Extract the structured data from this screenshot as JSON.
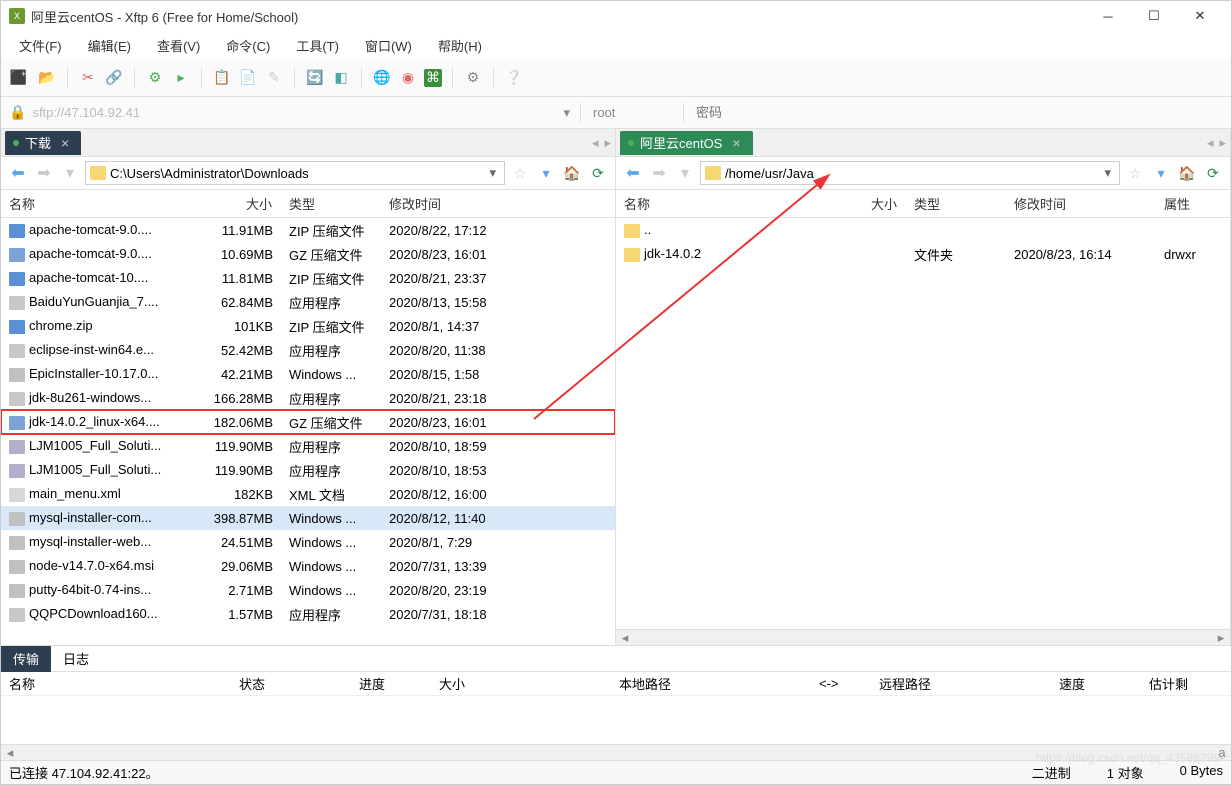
{
  "titlebar": {
    "title": "阿里云centOS - Xftp 6 (Free for Home/School)"
  },
  "menu": [
    "文件(F)",
    "编辑(E)",
    "查看(V)",
    "命令(C)",
    "工具(T)",
    "窗口(W)",
    "帮助(H)"
  ],
  "address": {
    "url": "sftp://47.104.92.41",
    "user": "root",
    "password_placeholder": "密码"
  },
  "left": {
    "tab": "下载",
    "path": "C:\\Users\\Administrator\\Downloads",
    "cols": {
      "name": "名称",
      "size": "大小",
      "type": "类型",
      "mtime": "修改时间"
    },
    "files": [
      {
        "name": "apache-tomcat-9.0....",
        "size": "11.91MB",
        "type": "ZIP 压缩文件",
        "mtime": "2020/8/22, 17:12",
        "icon": "zip"
      },
      {
        "name": "apache-tomcat-9.0....",
        "size": "10.69MB",
        "type": "GZ 压缩文件",
        "mtime": "2020/8/23, 16:01",
        "icon": "gz"
      },
      {
        "name": "apache-tomcat-10....",
        "size": "11.81MB",
        "type": "ZIP 压缩文件",
        "mtime": "2020/8/21, 23:37",
        "icon": "zip"
      },
      {
        "name": "BaiduYunGuanjia_7....",
        "size": "62.84MB",
        "type": "应用程序",
        "mtime": "2020/8/13, 15:58",
        "icon": "exe"
      },
      {
        "name": "chrome.zip",
        "size": "101KB",
        "type": "ZIP 压缩文件",
        "mtime": "2020/8/1, 14:37",
        "icon": "zip"
      },
      {
        "name": "eclipse-inst-win64.e...",
        "size": "52.42MB",
        "type": "应用程序",
        "mtime": "2020/8/20, 11:38",
        "icon": "exe"
      },
      {
        "name": "EpicInstaller-10.17.0...",
        "size": "42.21MB",
        "type": "Windows ...",
        "mtime": "2020/8/15, 1:58",
        "icon": "msi"
      },
      {
        "name": "jdk-8u261-windows...",
        "size": "166.28MB",
        "type": "应用程序",
        "mtime": "2020/8/21, 23:18",
        "icon": "exe"
      },
      {
        "name": "jdk-14.0.2_linux-x64....",
        "size": "182.06MB",
        "type": "GZ 压缩文件",
        "mtime": "2020/8/23, 16:01",
        "icon": "gz",
        "highlight": true
      },
      {
        "name": "LJM1005_Full_Soluti...",
        "size": "119.90MB",
        "type": "应用程序",
        "mtime": "2020/8/10, 18:59",
        "icon": "ins"
      },
      {
        "name": "LJM1005_Full_Soluti...",
        "size": "119.90MB",
        "type": "应用程序",
        "mtime": "2020/8/10, 18:53",
        "icon": "ins"
      },
      {
        "name": "main_menu.xml",
        "size": "182KB",
        "type": "XML 文档",
        "mtime": "2020/8/12, 16:00",
        "icon": "xml"
      },
      {
        "name": "mysql-installer-com...",
        "size": "398.87MB",
        "type": "Windows ...",
        "mtime": "2020/8/12, 11:40",
        "icon": "msi",
        "sel": true
      },
      {
        "name": "mysql-installer-web...",
        "size": "24.51MB",
        "type": "Windows ...",
        "mtime": "2020/8/1, 7:29",
        "icon": "msi"
      },
      {
        "name": "node-v14.7.0-x64.msi",
        "size": "29.06MB",
        "type": "Windows ...",
        "mtime": "2020/7/31, 13:39",
        "icon": "msi"
      },
      {
        "name": "putty-64bit-0.74-ins...",
        "size": "2.71MB",
        "type": "Windows ...",
        "mtime": "2020/8/20, 23:19",
        "icon": "msi"
      },
      {
        "name": "QQPCDownload160...",
        "size": "1.57MB",
        "type": "应用程序",
        "mtime": "2020/7/31, 18:18",
        "icon": "exe"
      }
    ]
  },
  "right": {
    "tab": "阿里云centOS",
    "path": "/home/usr/Java",
    "cols": {
      "name": "名称",
      "size": "大小",
      "type": "类型",
      "mtime": "修改时间",
      "attr": "属性"
    },
    "files": [
      {
        "name": "..",
        "size": "",
        "type": "",
        "mtime": "",
        "icon": "folder",
        "attr": ""
      },
      {
        "name": "jdk-14.0.2",
        "size": "",
        "type": "文件夹",
        "mtime": "2020/8/23, 16:14",
        "icon": "folder",
        "attr": "drwxr"
      }
    ]
  },
  "transfer": {
    "tabs": [
      "传输",
      "日志"
    ],
    "cols": {
      "name": "名称",
      "status": "状态",
      "progress": "进度",
      "size": "大小",
      "local": "本地路径",
      "dir": "<->",
      "remote": "远程路径",
      "speed": "速度",
      "eta": "估计剩"
    }
  },
  "status": {
    "left": "已连接 47.104.92.41:22。",
    "binary": "二进制",
    "objects": "1 对象",
    "bytes": "0 Bytes"
  },
  "watermark": "https://blog.csdn.net/qq_43588799"
}
